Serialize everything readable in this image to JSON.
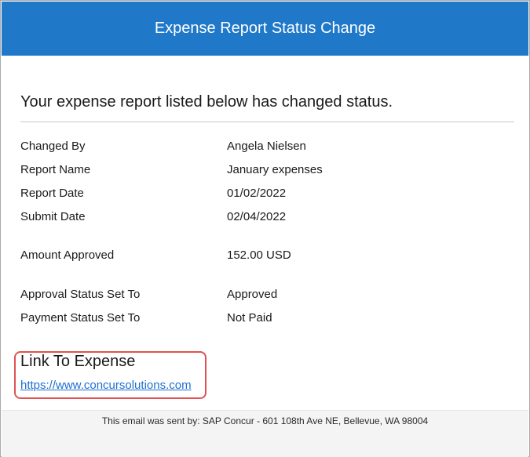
{
  "header": {
    "title": "Expense Report Status Change"
  },
  "intro": "Your expense report listed below has changed status.",
  "details": [
    {
      "label": "Changed By",
      "value": "Angela Nielsen"
    },
    {
      "label": "Report Name",
      "value": "January expenses"
    },
    {
      "label": "Report Date",
      "value": "01/02/2022"
    },
    {
      "label": "Submit Date",
      "value": "02/04/2022"
    },
    {
      "label": "Amount Approved",
      "value": "152.00 USD"
    },
    {
      "label": "Approval Status Set To",
      "value": "Approved"
    },
    {
      "label": "Payment Status Set To",
      "value": "Not Paid"
    }
  ],
  "link": {
    "heading": "Link To Expense",
    "url": "https://www.concursolutions.com"
  },
  "footer": "This email was sent by: SAP Concur - 601 108th Ave NE, Bellevue, WA 98004",
  "colors": {
    "header_bg": "#1f78c8",
    "link": "#1f6fd1",
    "highlight_border": "#e05252"
  }
}
